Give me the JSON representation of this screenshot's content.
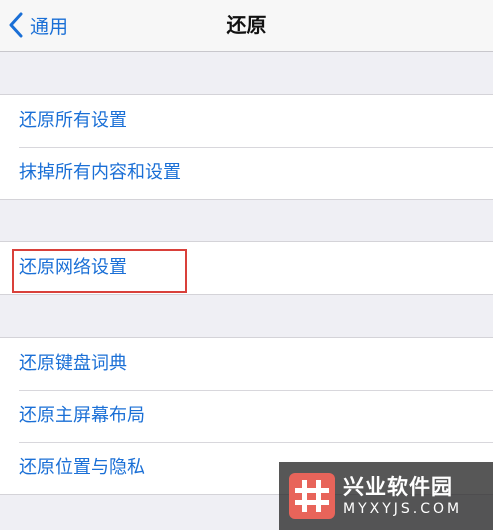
{
  "nav": {
    "back_label": "通用",
    "title": "还原"
  },
  "groups": [
    {
      "items": [
        {
          "label": "还原所有设置"
        },
        {
          "label": "抹掉所有内容和设置"
        }
      ]
    },
    {
      "items": [
        {
          "label": "还原网络设置",
          "highlighted": true
        }
      ]
    },
    {
      "items": [
        {
          "label": "还原键盘词典"
        },
        {
          "label": "还原主屏幕布局"
        },
        {
          "label": "还原位置与隐私"
        }
      ]
    }
  ],
  "watermark": {
    "title": "兴业软件园",
    "url": "MYXYJS.COM"
  },
  "colors": {
    "accent": "#1a6fd6",
    "highlight_border": "#d9403a",
    "background": "#efeff4",
    "watermark_logo": "#e8645a"
  },
  "icons": {
    "back": "chevron-left-icon",
    "watermark_logo": "hash-logo-icon"
  }
}
